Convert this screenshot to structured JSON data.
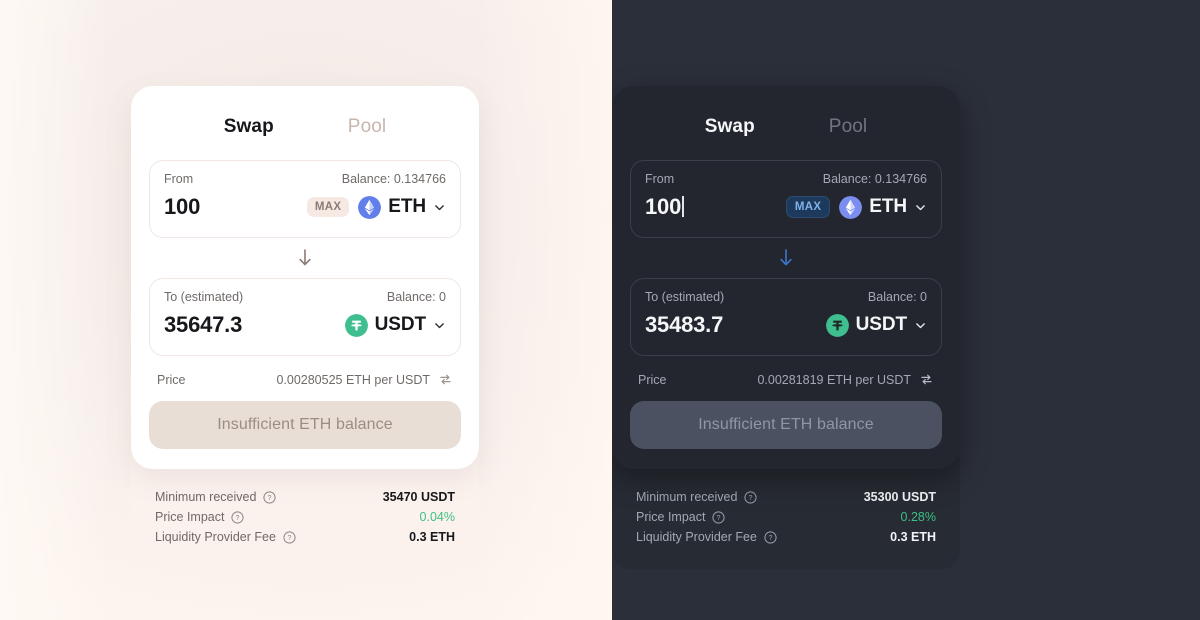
{
  "light": {
    "theme_name": "light",
    "tabs": [
      {
        "label": "Swap",
        "active": true
      },
      {
        "label": "Pool",
        "active": false
      }
    ],
    "from": {
      "label": "From",
      "balance": "Balance: 0.134766",
      "amount": "100",
      "max_label": "MAX",
      "token": "ETH",
      "token_icon": "ethereum-icon"
    },
    "swap_arrow_icon": "arrow-down-icon",
    "to": {
      "label": "To (estimated)",
      "balance": "Balance: 0",
      "amount": "35647.3",
      "token": "USDT",
      "token_icon": "tether-icon"
    },
    "price": {
      "label": "Price",
      "value": "0.00280525 ETH per USDT",
      "refresh_icon": "swap-refresh-icon"
    },
    "cta_label": "Insufficient ETH balance",
    "details": [
      {
        "label": "Minimum received",
        "value": "35470 USDT",
        "help_icon": "question-circle-icon",
        "accent": false
      },
      {
        "label": "Price Impact",
        "value": "0.04%",
        "help_icon": "question-circle-icon",
        "accent": true
      },
      {
        "label": "Liquidity Provider Fee",
        "value": "0.3 ETH",
        "help_icon": "question-circle-icon",
        "accent": false
      }
    ]
  },
  "dark": {
    "theme_name": "dark",
    "tabs": [
      {
        "label": "Swap",
        "active": true
      },
      {
        "label": "Pool",
        "active": false
      }
    ],
    "from": {
      "label": "From",
      "balance": "Balance: 0.134766",
      "amount": "100",
      "max_label": "MAX",
      "token": "ETH",
      "token_icon": "ethereum-icon"
    },
    "swap_arrow_icon": "arrow-down-icon",
    "to": {
      "label": "To (estimated)",
      "balance": "Balance: 0",
      "amount": "35483.7",
      "token": "USDT",
      "token_icon": "tether-icon"
    },
    "price": {
      "label": "Price",
      "value": "0.00281819 ETH per USDT",
      "refresh_icon": "swap-refresh-icon"
    },
    "cta_label": "Insufficient ETH balance",
    "details": [
      {
        "label": "Minimum received",
        "value": "35300 USDT",
        "help_icon": "question-circle-icon",
        "accent": false
      },
      {
        "label": "Price Impact",
        "value": "0.28%",
        "help_icon": "question-circle-icon",
        "accent": true
      },
      {
        "label": "Liquidity Provider Fee",
        "value": "0.3 ETH",
        "help_icon": "question-circle-icon",
        "accent": false
      }
    ]
  },
  "colors": {
    "light_bg": "#f7efeb",
    "dark_bg": "#2b2f3a",
    "dark_card": "#23262e",
    "accent_green": "#3fbf83",
    "ethereum_blue": "#627eea",
    "tether_green": "#3fbf8f",
    "dark_arrow_blue": "#3b72c4",
    "light_arrow_taupe": "#8c7b74"
  }
}
